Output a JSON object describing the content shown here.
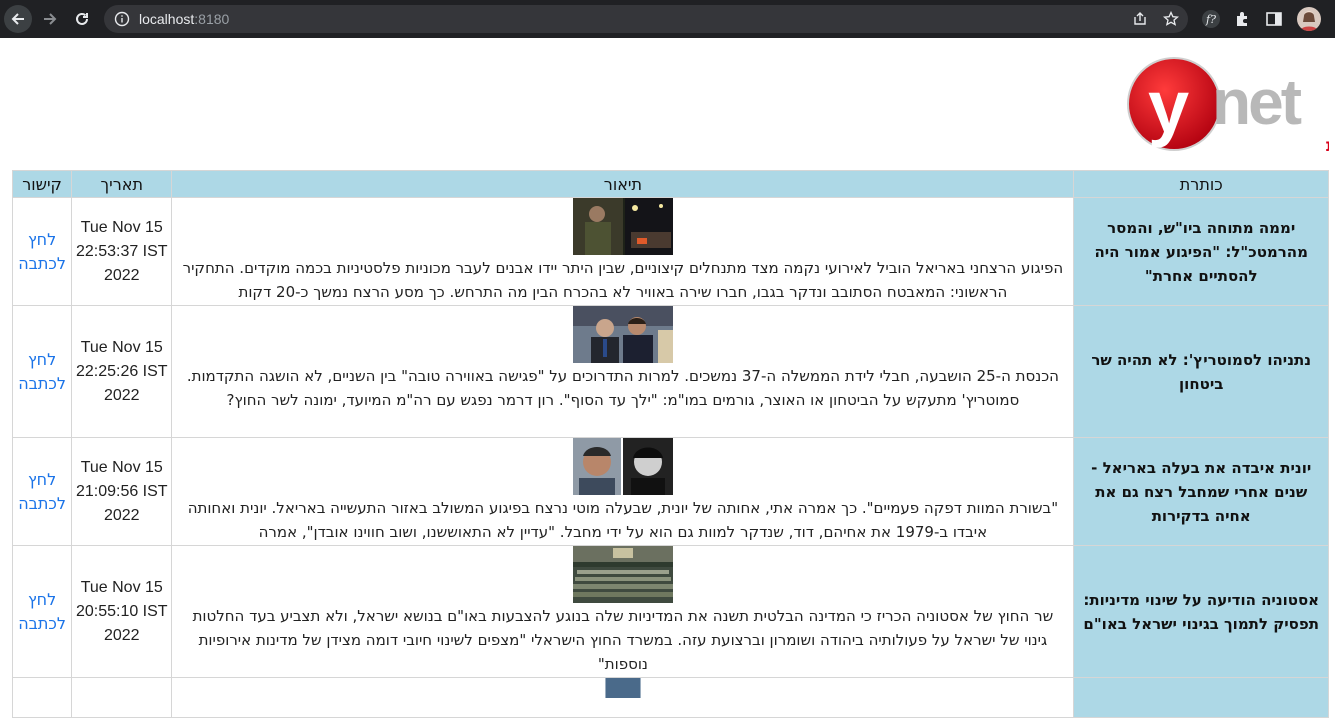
{
  "browser": {
    "url_host": "localhost",
    "url_port": ":8180"
  },
  "logo": {
    "text": "ynet",
    "subtitle": "ידיעות אחרונות"
  },
  "table": {
    "headers": {
      "title": "כותרת",
      "description": "תיאור",
      "date": "תאריך",
      "link": "קישור"
    },
    "rows": [
      {
        "title": "יממה מתוחה ביו\"ש, והמסר מהרמטכ\"ל: \"הפיגוע אמור היה להסתיים אחרת\"",
        "description": "הפיגוע הרצחני באריאל הוביל לאירועי נקמה מצד מתנחלים קיצוניים, שבין היתר יידו אבנים לעבר מכוניות פלסטיניות בכמה מוקדים. התחקיר הראשוני: המאבטח הסתובב ונדקר בגבו, חברו שירה באוויר לא בהכרח הבין מה התרחש. כך מסע הרצח נמשך כ-20 דקות",
        "date_line1": "Tue Nov 15",
        "date_line2": "22:53:37 IST",
        "date_line3": "2022",
        "link_text": "לחץ לכתבה",
        "image_kind": "soldier-night"
      },
      {
        "title": "נתניהו לסמוטריץ': לא תהיה שר ביטחון",
        "description": "הכנסת ה-25 הושבעה, חבלי לידת הממשלה ה-37 נמשכים. למרות התדרוכים על \"פגישה באווירה טובה\" בין השניים, לא הושגה התקדמות. סמוטריץ' מתעקש על הביטחון או האוצר, גורמים במו\"מ: \"ילך עד הסוף\". רון דרמר נפגש עם רה\"מ המיועד, ימונה לשר החוץ?",
        "date_line1": "Tue Nov 15",
        "date_line2": "22:25:26 IST",
        "date_line3": "2022",
        "link_text": "לחץ לכתבה",
        "image_kind": "politicians"
      },
      {
        "title": "יונית איבדה את בעלה באריאל - שנים אחרי שמחבל רצח גם את אחיה בדקירות",
        "description": "\"בשורת המוות דפקה פעמיים\". כך אמרה אתי, אחותה של יונית, שבעלה מוטי נרצח בפיגוע המשולב באזור התעשייה באריאל. יונית ואחותה איבדו ב-1979 את אחיהם, דוד, שנדקר למוות גם הוא על ידי מחבל. \"עדיין לא התאוששנו, ושוב חווינו אובדן\", אמרה",
        "date_line1": "Tue Nov 15",
        "date_line2": "21:09:56 IST",
        "date_line3": "2022",
        "link_text": "לחץ לכתבה",
        "image_kind": "portraits"
      },
      {
        "title": "אסטוניה הודיעה על שינוי מדיניות: תפסיק לתמוך בגינוי ישראל באו\"ם",
        "description": "שר החוץ של אסטוניה הכריז כי המדינה הבלטית תשנה את המדיניות שלה בנוגע להצבעות באו\"ם בנושא ישראל, ולא תצביע בעד החלטות גינוי של ישראל על פעולותיה ביהודה ושומרון וברצועת עזה. במשרד החוץ הישראלי \"מצפים לשינוי חיובי דומה מצידן של מדינות אירופיות נוספות\"",
        "date_line1": "Tue Nov 15",
        "date_line2": "20:55:10 IST",
        "date_line3": "2022",
        "link_text": "לחץ לכתבה",
        "image_kind": "assembly-hall"
      }
    ]
  },
  "colors": {
    "header_bg": "#add8e6",
    "link": "#1a73e8",
    "chrome_bg": "#202124",
    "logo_red": "#d8001a"
  }
}
